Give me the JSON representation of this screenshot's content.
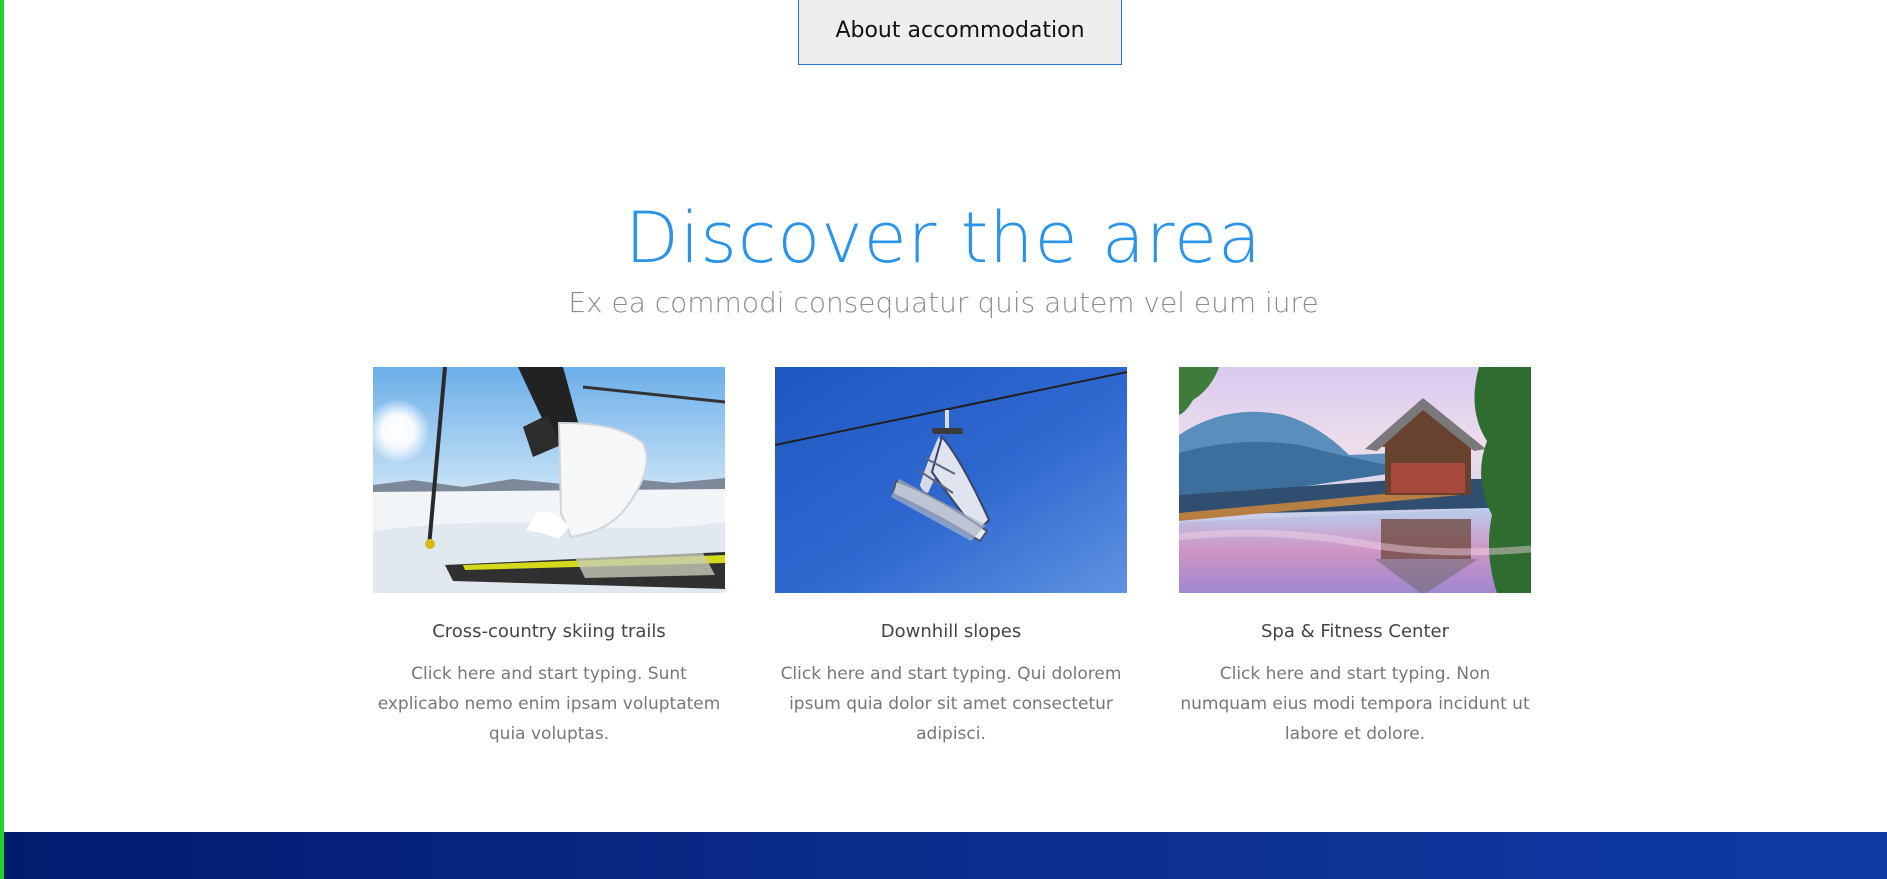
{
  "page": {
    "accent_color": "#2a93ea",
    "left_bar_color": "#22d12b",
    "footer_color": "#0a2581"
  },
  "about_section": {
    "button_label": "About accommodation"
  },
  "discover_section": {
    "title": "Discover the area",
    "subtitle": "Ex ea commodi consequatur quis autem vel eum iure",
    "cards": [
      {
        "image_name": "cross-country-skier-image",
        "title": "Cross-country skiing trails",
        "text": "Click here and start typing. Sunt explicabo nemo enim ipsam voluptatem quia voluptas."
      },
      {
        "image_name": "ski-chairlift-image",
        "title": "Downhill slopes",
        "text": "Click here and start typing. Qui dolorem ipsum quia dolor sit amet consectetur adipisci."
      },
      {
        "image_name": "mountain-spa-reflection-image",
        "title": "Spa & Fitness Center",
        "text": "Click here and start typing. Non numquam eius modi tempora incidunt ut labore et dolore."
      }
    ]
  }
}
